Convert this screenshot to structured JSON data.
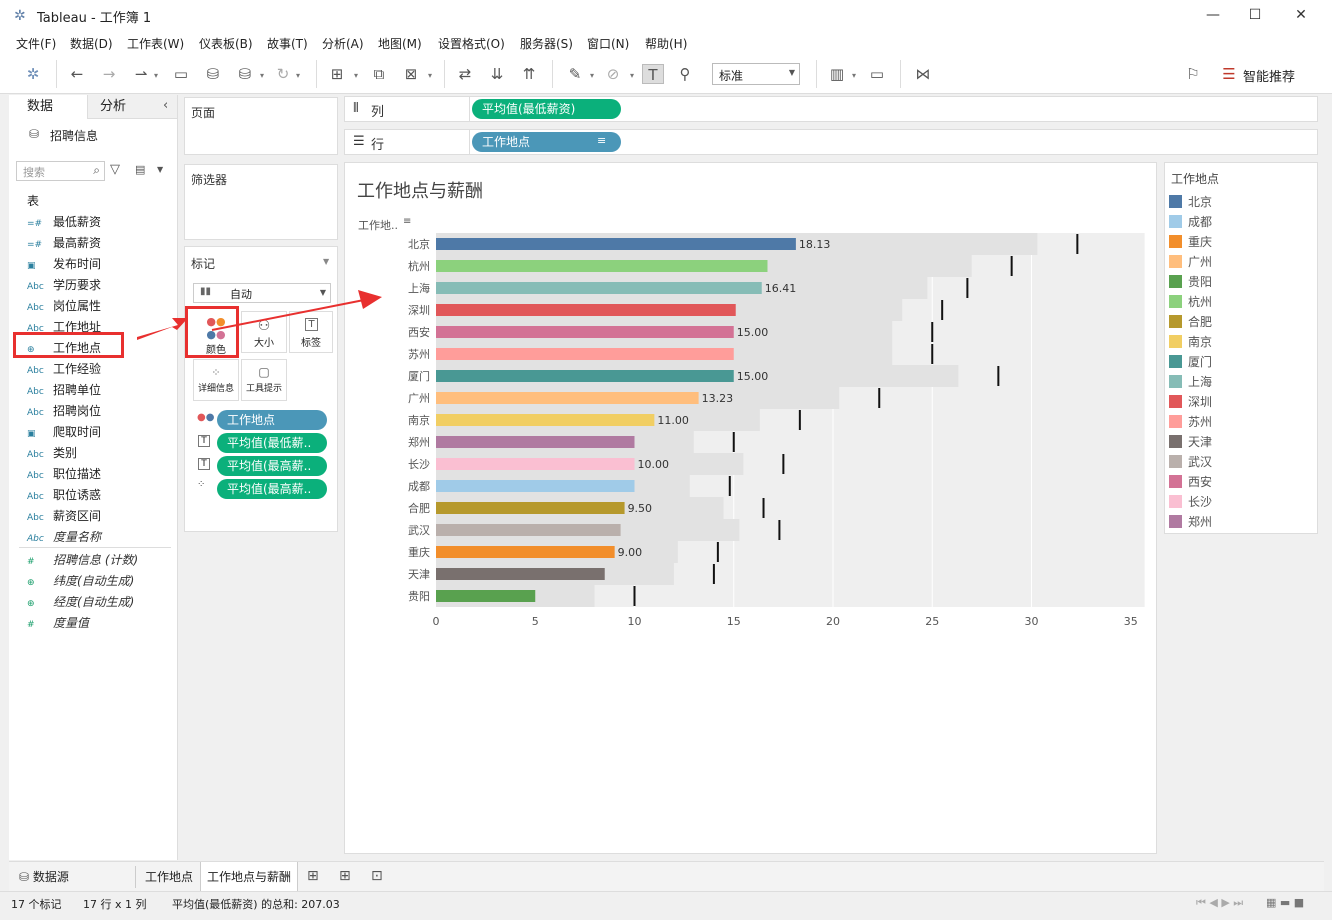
{
  "window": {
    "title": "Tableau - 工作簿 1",
    "minimize": "—",
    "maximize": "☐",
    "close": "✕"
  },
  "menu": [
    "文件(F)",
    "数据(D)",
    "工作表(W)",
    "仪表板(B)",
    "故事(T)",
    "分析(A)",
    "地图(M)",
    "设置格式(O)",
    "服务器(S)",
    "窗口(N)",
    "帮助(H)"
  ],
  "toolbar": {
    "fit": "标准",
    "smart": "智能推荐"
  },
  "left_panel": {
    "tab_data": "数据",
    "tab_analysis": "分析",
    "datasource": "招聘信息",
    "search_placeholder": "搜索",
    "section_table": "表",
    "fields": [
      {
        "icon": "=#",
        "name": "最低薪资"
      },
      {
        "icon": "=#",
        "name": "最高薪资"
      },
      {
        "icon": "▣",
        "name": "发布时间"
      },
      {
        "icon": "Abc",
        "name": "学历要求"
      },
      {
        "icon": "Abc",
        "name": "岗位属性"
      },
      {
        "icon": "Abc",
        "name": "工作地址"
      },
      {
        "icon": "⊕",
        "name": "工作地点"
      },
      {
        "icon": "Abc",
        "name": "工作经验"
      },
      {
        "icon": "Abc",
        "name": "招聘单位"
      },
      {
        "icon": "Abc",
        "name": "招聘岗位"
      },
      {
        "icon": "▣",
        "name": "爬取时间"
      },
      {
        "icon": "Abc",
        "name": "类别"
      },
      {
        "icon": "Abc",
        "name": "职位描述"
      },
      {
        "icon": "Abc",
        "name": "职位诱惑"
      },
      {
        "icon": "Abc",
        "name": "薪资区间"
      },
      {
        "icon": "Abc",
        "name": "度量名称"
      }
    ],
    "measures": [
      {
        "icon": "#",
        "name": "招聘信息 (计数)"
      },
      {
        "icon": "⊕",
        "name": "纬度(自动生成)"
      },
      {
        "icon": "⊕",
        "name": "经度(自动生成)"
      },
      {
        "icon": "#",
        "name": "度量值"
      }
    ]
  },
  "cards": {
    "pages": "页面",
    "filters": "筛选器",
    "marks": "标记",
    "mark_type": "自动",
    "color": "颜色",
    "size": "大小",
    "label": "标签",
    "detail": "详细信息",
    "tooltip": "工具提示",
    "mark_pills": [
      "工作地点",
      "平均值(最低薪..",
      "平均值(最高薪..",
      "平均值(最高薪.."
    ]
  },
  "shelves": {
    "columns_label": "列",
    "rows_label": "行",
    "columns_pill": "平均值(最低薪资)",
    "rows_pill": "工作地点"
  },
  "view": {
    "title": "工作地点与薪酬",
    "row_header": "工作地.."
  },
  "chart_data": {
    "type": "bar",
    "title": "工作地点与薪酬",
    "categories": [
      "北京",
      "杭州",
      "上海",
      "深圳",
      "西安",
      "苏州",
      "厦门",
      "广州",
      "南京",
      "郑州",
      "长沙",
      "成都",
      "合肥",
      "武汉",
      "重庆",
      "天津",
      "贵阳"
    ],
    "series": [
      {
        "name": "平均值(最低薪资)",
        "values": [
          18.13,
          16.7,
          16.41,
          15.1,
          15.0,
          15.0,
          15.0,
          13.23,
          11.0,
          10.0,
          10.0,
          10.0,
          9.5,
          9.3,
          9.0,
          8.5,
          5.0
        ]
      },
      {
        "name": "平均值(最高薪资)",
        "values": [
          32.31,
          29.0,
          26.77,
          25.5,
          25.0,
          25.0,
          28.33,
          22.33,
          18.33,
          15.0,
          17.5,
          14.8,
          16.5,
          17.3,
          14.2,
          14.0,
          10.0
        ]
      }
    ],
    "bar_labels_min": [
      "18.13",
      "",
      "16.41",
      "",
      "15.00",
      "",
      "15.00",
      "13.23",
      "11.00",
      "",
      "10.00",
      "",
      "9.50",
      "",
      "9.00",
      "",
      ""
    ],
    "bar_labels_max": [
      "32.31",
      "",
      "26.77",
      "",
      "25.00",
      "",
      "28.33",
      "22.33",
      "18.33",
      "",
      "17.50",
      "",
      "16.50",
      "",
      "14.20",
      "",
      ""
    ],
    "xticks": [
      "0",
      "5",
      "10",
      "15",
      "20",
      "25",
      "30",
      "35"
    ],
    "xlim": [
      0,
      35
    ],
    "colors": [
      "#4e79a7",
      "#8cd17d",
      "#86bcb6",
      "#e15759",
      "#d37295",
      "#ff9d9a",
      "#499894",
      "#ffbe7d",
      "#f1ce63",
      "#b07aa1",
      "#fabfd2",
      "#a0cbe8",
      "#b6992d",
      "#bab0ac",
      "#f28e2b",
      "#79706e",
      "#59a14f"
    ]
  },
  "legend": {
    "title": "工作地点",
    "items": [
      {
        "name": "北京",
        "color": "#4e79a7"
      },
      {
        "name": "成都",
        "color": "#a0cbe8"
      },
      {
        "name": "重庆",
        "color": "#f28e2b"
      },
      {
        "name": "广州",
        "color": "#ffbe7d"
      },
      {
        "name": "贵阳",
        "color": "#59a14f"
      },
      {
        "name": "杭州",
        "color": "#8cd17d"
      },
      {
        "name": "合肥",
        "color": "#b6992d"
      },
      {
        "name": "南京",
        "color": "#f1ce63"
      },
      {
        "name": "厦门",
        "color": "#499894"
      },
      {
        "name": "上海",
        "color": "#86bcb6"
      },
      {
        "name": "深圳",
        "color": "#e15759"
      },
      {
        "name": "苏州",
        "color": "#ff9d9a"
      },
      {
        "name": "天津",
        "color": "#79706e"
      },
      {
        "name": "武汉",
        "color": "#bab0ac"
      },
      {
        "name": "西安",
        "color": "#d37295"
      },
      {
        "name": "长沙",
        "color": "#fabfd2"
      },
      {
        "name": "郑州",
        "color": "#b07aa1"
      }
    ]
  },
  "bottom_tabs": {
    "datasource": "数据源",
    "sheet1": "工作地点",
    "sheet2": "工作地点与薪酬"
  },
  "status": {
    "marks": "17 个标记",
    "rows": "17 行 x 1 列",
    "sum": "平均值(最低薪资) 的总和: 207.03"
  }
}
